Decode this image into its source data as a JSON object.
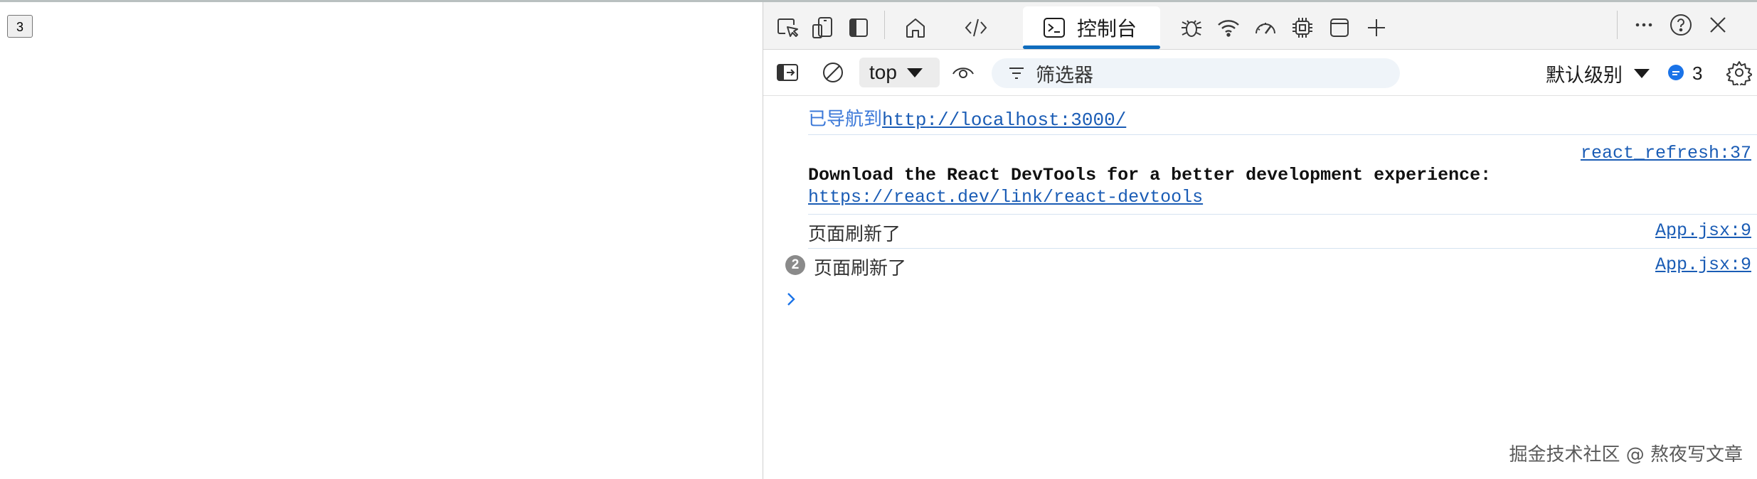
{
  "page": {
    "button_value": "3"
  },
  "devtools": {
    "toolbar": {
      "tabs": {
        "console_label": "控制台"
      },
      "icons": [
        "inspect-icon",
        "device-emulation-icon",
        "dock-side-icon",
        "home-icon",
        "elements-icon",
        "console-icon",
        "sources-debug-icon",
        "network-icon",
        "performance-icon",
        "memory-icon",
        "application-icon",
        "add-tool-icon",
        "more-icon",
        "help-icon",
        "close-icon"
      ]
    },
    "filterbar": {
      "context": "top",
      "filter_placeholder": "筛选器",
      "level": "默认级别",
      "issues_count": "3"
    },
    "console": {
      "nav_prefix": "已导航到",
      "nav_url": "http://localhost:3000/",
      "react_source": "react_refresh:37",
      "react_line1": "Download the React DevTools for a better development experience:",
      "react_link": "https://react.dev/link/react-devtools",
      "log1_text": "页面刷新了",
      "log1_source": "App.jsx:9",
      "log2_count": "2",
      "log2_text": "页面刷新了",
      "log2_source": "App.jsx:9"
    }
  },
  "watermark": "掘金技术社区 @ 熬夜写文章",
  "colors": {
    "accent": "#0f6cbd",
    "link": "#1a5cb5",
    "nav_text": "#3b78d8",
    "toolbar_bg": "#f3f3f3"
  }
}
